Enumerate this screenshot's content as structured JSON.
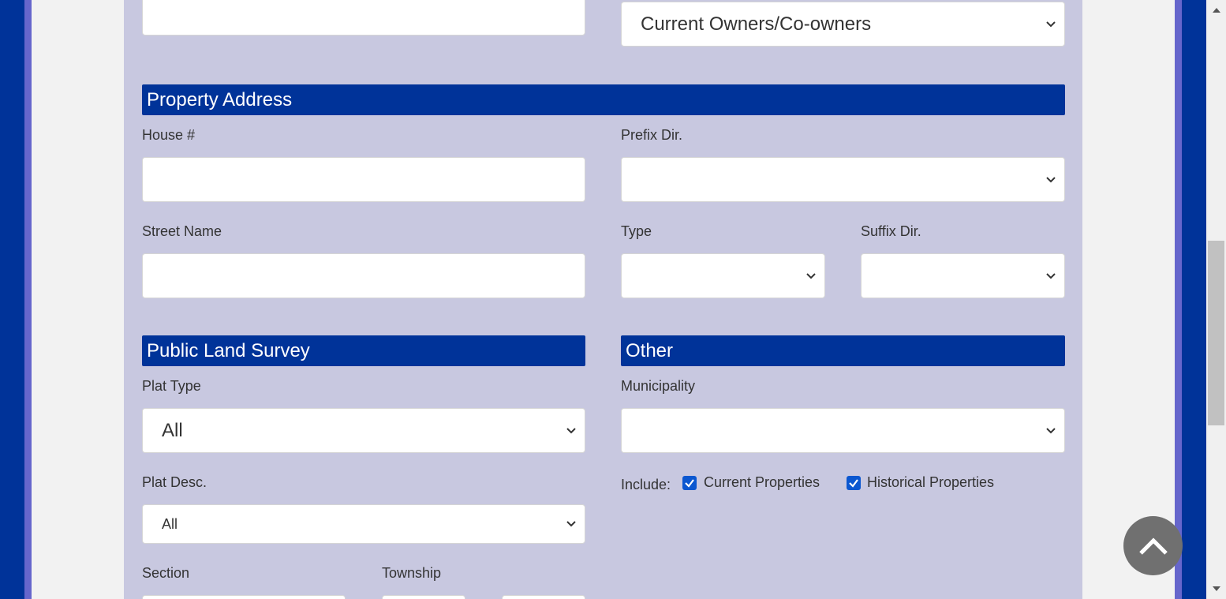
{
  "owner_type_select": {
    "value": "Current Owners/Co-owners"
  },
  "property_address": {
    "title": "Property Address",
    "house_number_label": "House #",
    "prefix_dir_label": "Prefix Dir.",
    "street_name_label": "Street Name",
    "type_label": "Type",
    "suffix_dir_label": "Suffix Dir."
  },
  "public_land_survey": {
    "title": "Public Land Survey",
    "plat_type_label": "Plat Type",
    "plat_type_value": "All",
    "plat_desc_label": "Plat Desc.",
    "plat_desc_value": "All",
    "section_label": "Section",
    "township_label": "Township"
  },
  "other": {
    "title": "Other",
    "municipality_label": "Municipality",
    "include_label": "Include:",
    "current_properties_label": "Current Properties",
    "historical_properties_label": "Historical Properties"
  },
  "colors": {
    "header_blue": "#003399",
    "panel_lavender": "#c8c8e0",
    "checkbox_blue": "#0b57d0"
  }
}
